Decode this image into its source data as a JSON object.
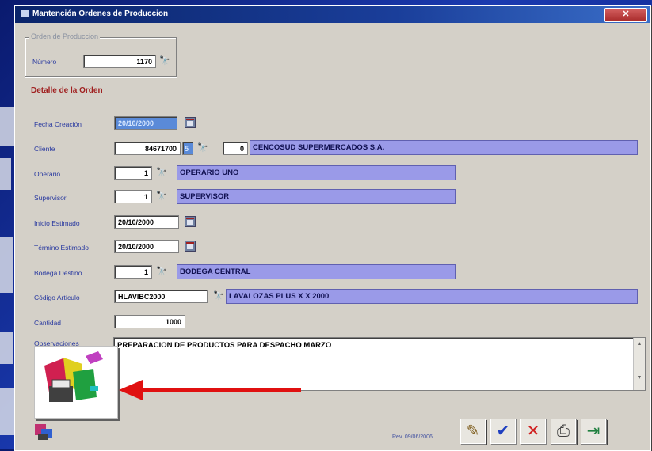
{
  "window": {
    "title": "Mantención Ordenes de Produccion",
    "close_label": "✕"
  },
  "orden_group": {
    "title": "Orden de Produccion",
    "numero_label": "Número",
    "numero_value": "1170"
  },
  "detalle": {
    "title": "Detalle de la Orden",
    "fecha_creacion_label": "Fecha Creación",
    "fecha_creacion_value": "20/10/2000",
    "cliente_label": "Cliente",
    "cliente_rut": "84671700",
    "cliente_dv": "5",
    "cliente_suc": "0",
    "cliente_nombre": "CENCOSUD SUPERMERCADOS S.A.",
    "operario_label": "Operario",
    "operario_code": "1",
    "operario_nombre": "OPERARIO UNO",
    "supervisor_label": "Supervisor",
    "supervisor_code": "1",
    "supervisor_nombre": "SUPERVISOR",
    "inicio_label": "Inicio Estimado",
    "inicio_value": "20/10/2000",
    "termino_label": "Término Estimado",
    "termino_value": "20/10/2000",
    "bodega_label": "Bodega Destino",
    "bodega_code": "1",
    "bodega_nombre": "BODEGA CENTRAL",
    "codigo_label": "Código Artículo",
    "codigo_value": "HLAVIBC2000",
    "articulo_nombre": "LAVALOZAS PLUS X X 2000",
    "cantidad_label": "Cantidad",
    "cantidad_value": "1000",
    "observaciones_label": "Observaciones",
    "observaciones_value": "PREPARACION DE PRODUCTOS PARA DESPACHO MARZO"
  },
  "footer": {
    "rev": "Rev. 09/06/2006"
  },
  "colors": {
    "accent_arrow": "#e01010",
    "display_fill": "#9a9ae8"
  }
}
